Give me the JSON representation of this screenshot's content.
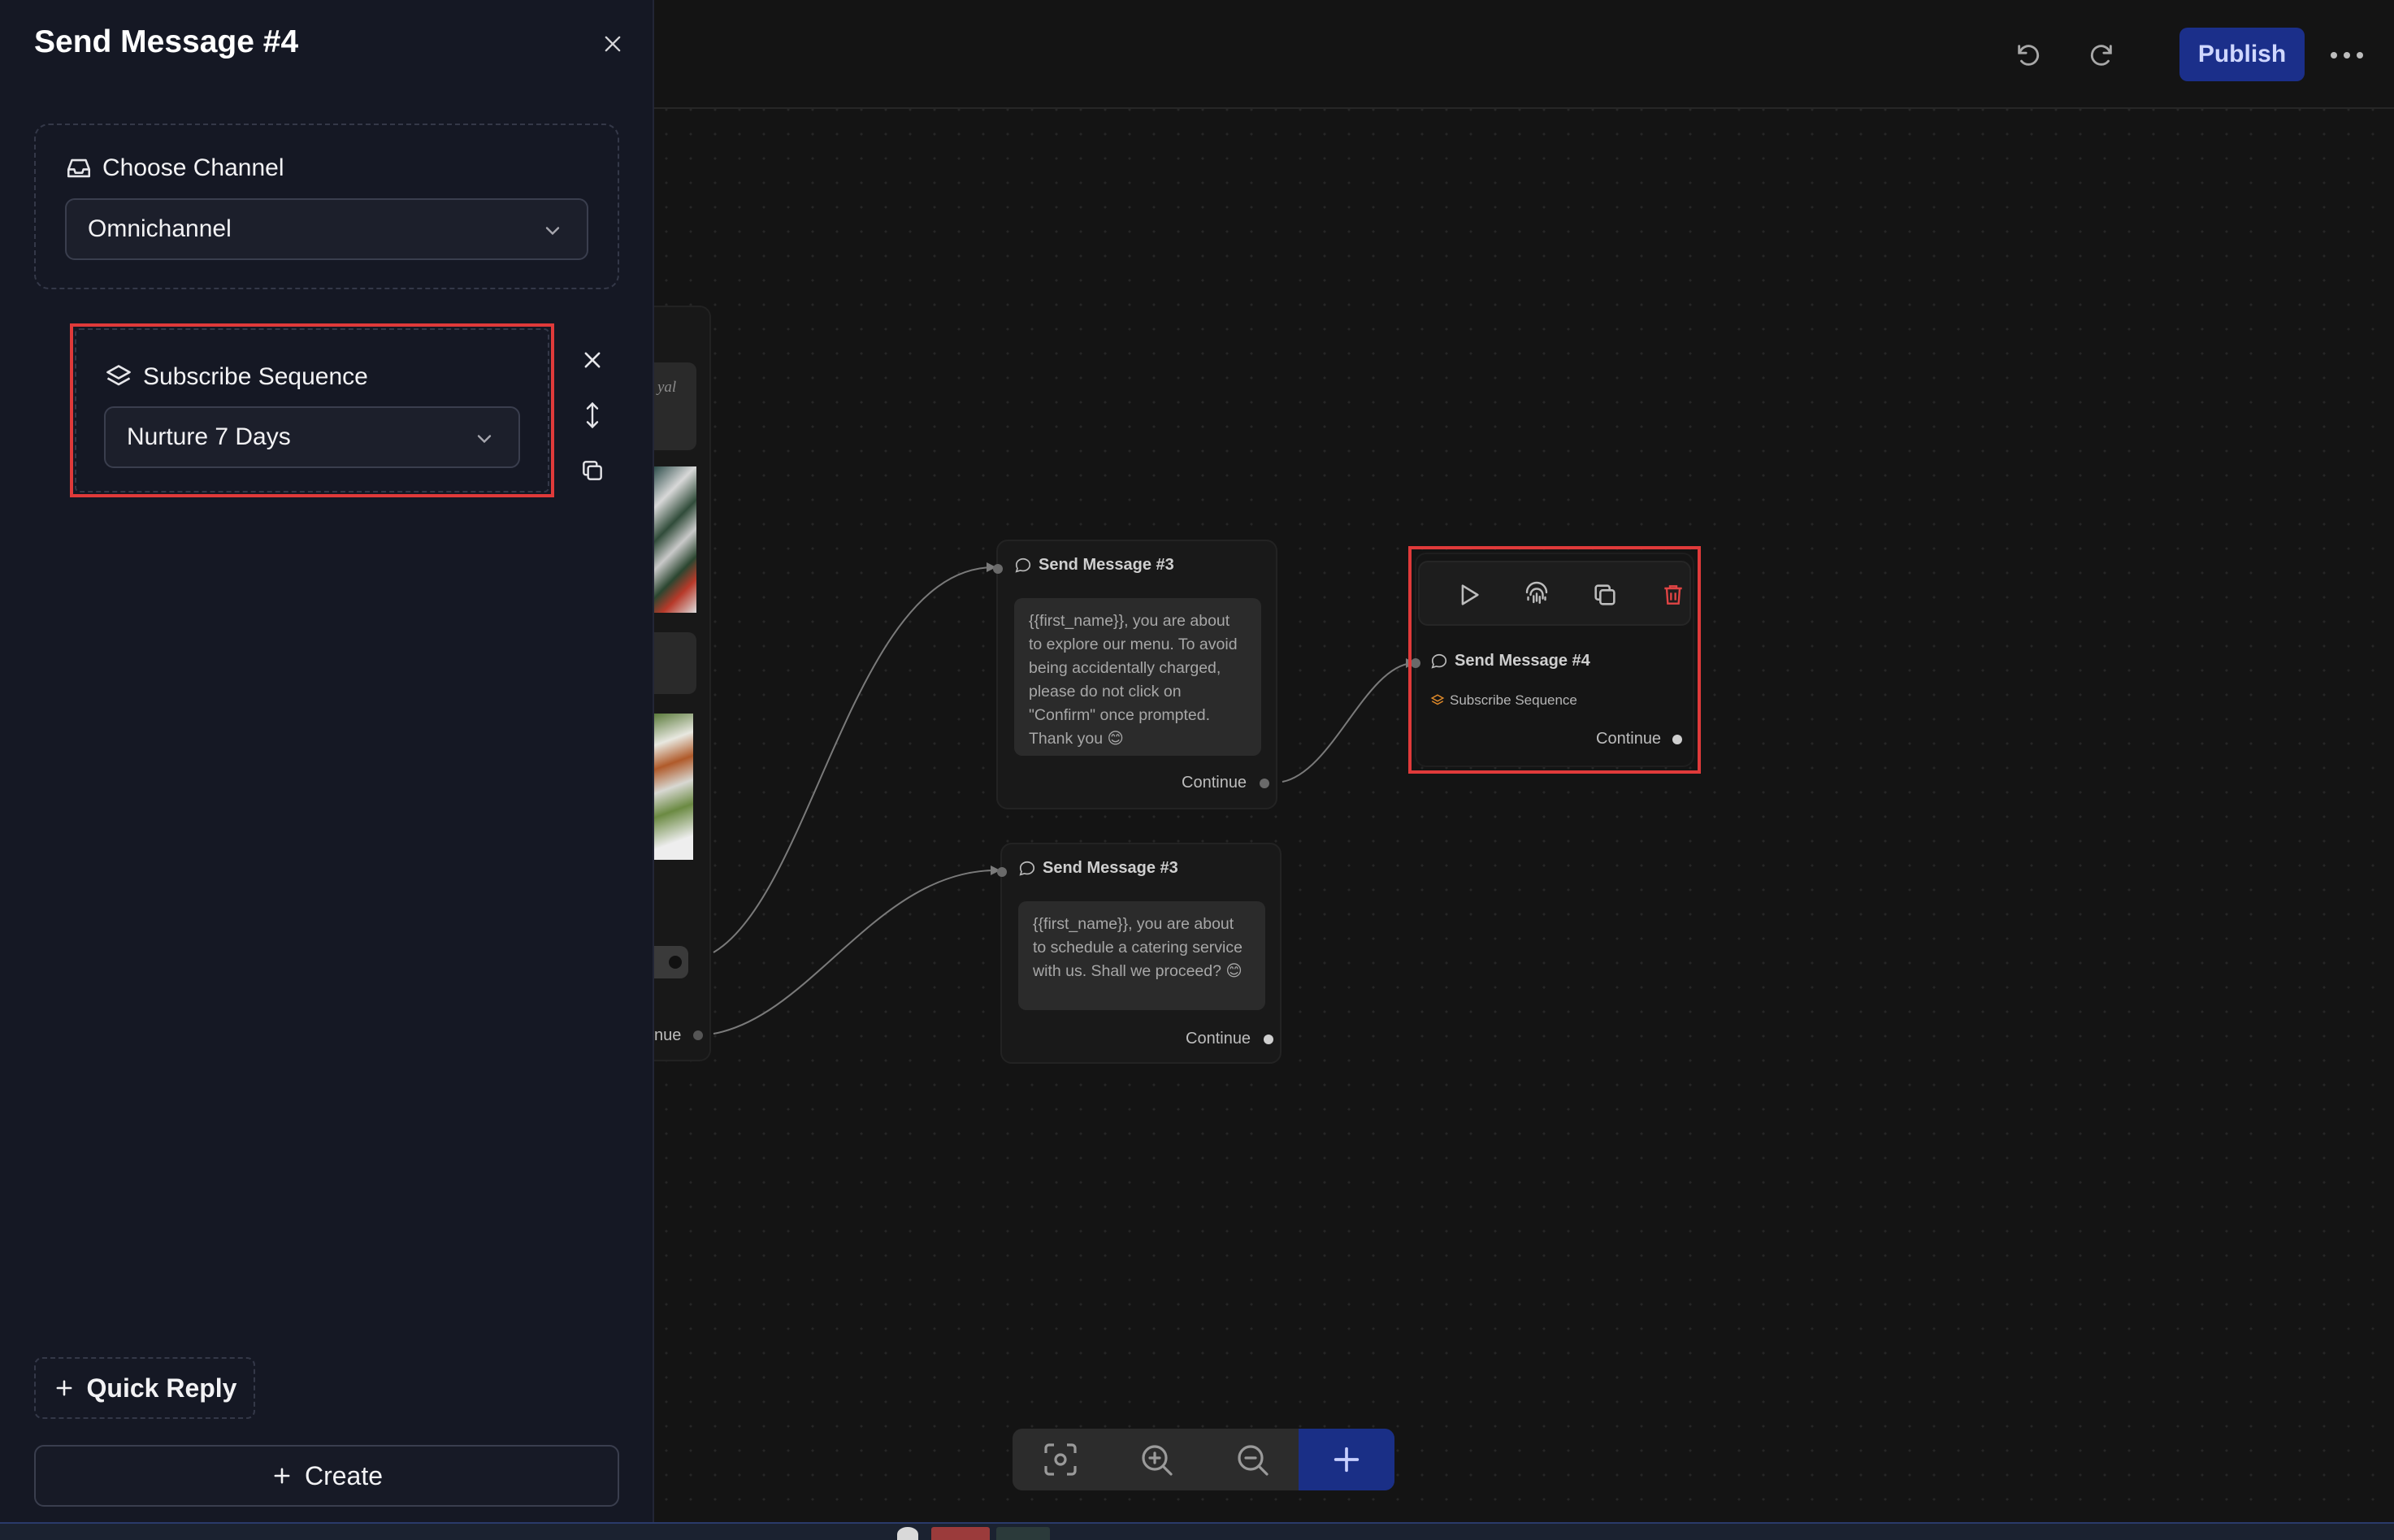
{
  "panel": {
    "title": "Send Message #4",
    "channel_label": "Choose Channel",
    "channel_value": "Omnichannel",
    "sequence_label": "Subscribe Sequence",
    "sequence_value": "Nurture 7 Days",
    "quick_reply_label": "Quick Reply",
    "create_label": "Create"
  },
  "toolbar": {
    "publish_label": "Publish"
  },
  "canvas": {
    "partial_node": {
      "text_fragment": "yal",
      "continue_fragment": "nue"
    },
    "nodes": [
      {
        "title": "Send Message #3",
        "message": "{{first_name}}, you are about to explore our menu. To avoid being accidentally charged, please do not click on \"Confirm\" once prompted. Thank you 😊",
        "continue_label": "Continue"
      },
      {
        "title": "Send Message #3",
        "message": "{{first_name}}, you are about to schedule a catering service with us. Shall we proceed? 😊",
        "continue_label": "Continue"
      },
      {
        "title": "Send Message #4",
        "subtitle": "Subscribe Sequence",
        "continue_label": "Continue"
      }
    ]
  },
  "colors": {
    "highlight": "#e03a3a",
    "publish_bg": "#1b2f8a",
    "add_button_bg": "#1a2f86",
    "delete_icon": "#e04444",
    "sequence_icon": "#e08a2a"
  },
  "icons": [
    "undo-icon",
    "redo-icon",
    "more-icon",
    "close-icon",
    "inbox-icon",
    "layers-icon",
    "chevron-down-icon",
    "reorder-icon",
    "copy-icon",
    "plus-icon",
    "play-icon",
    "fingerprint-icon",
    "trash-icon",
    "message-icon",
    "focus-icon",
    "zoom-in-icon",
    "zoom-out-icon"
  ]
}
